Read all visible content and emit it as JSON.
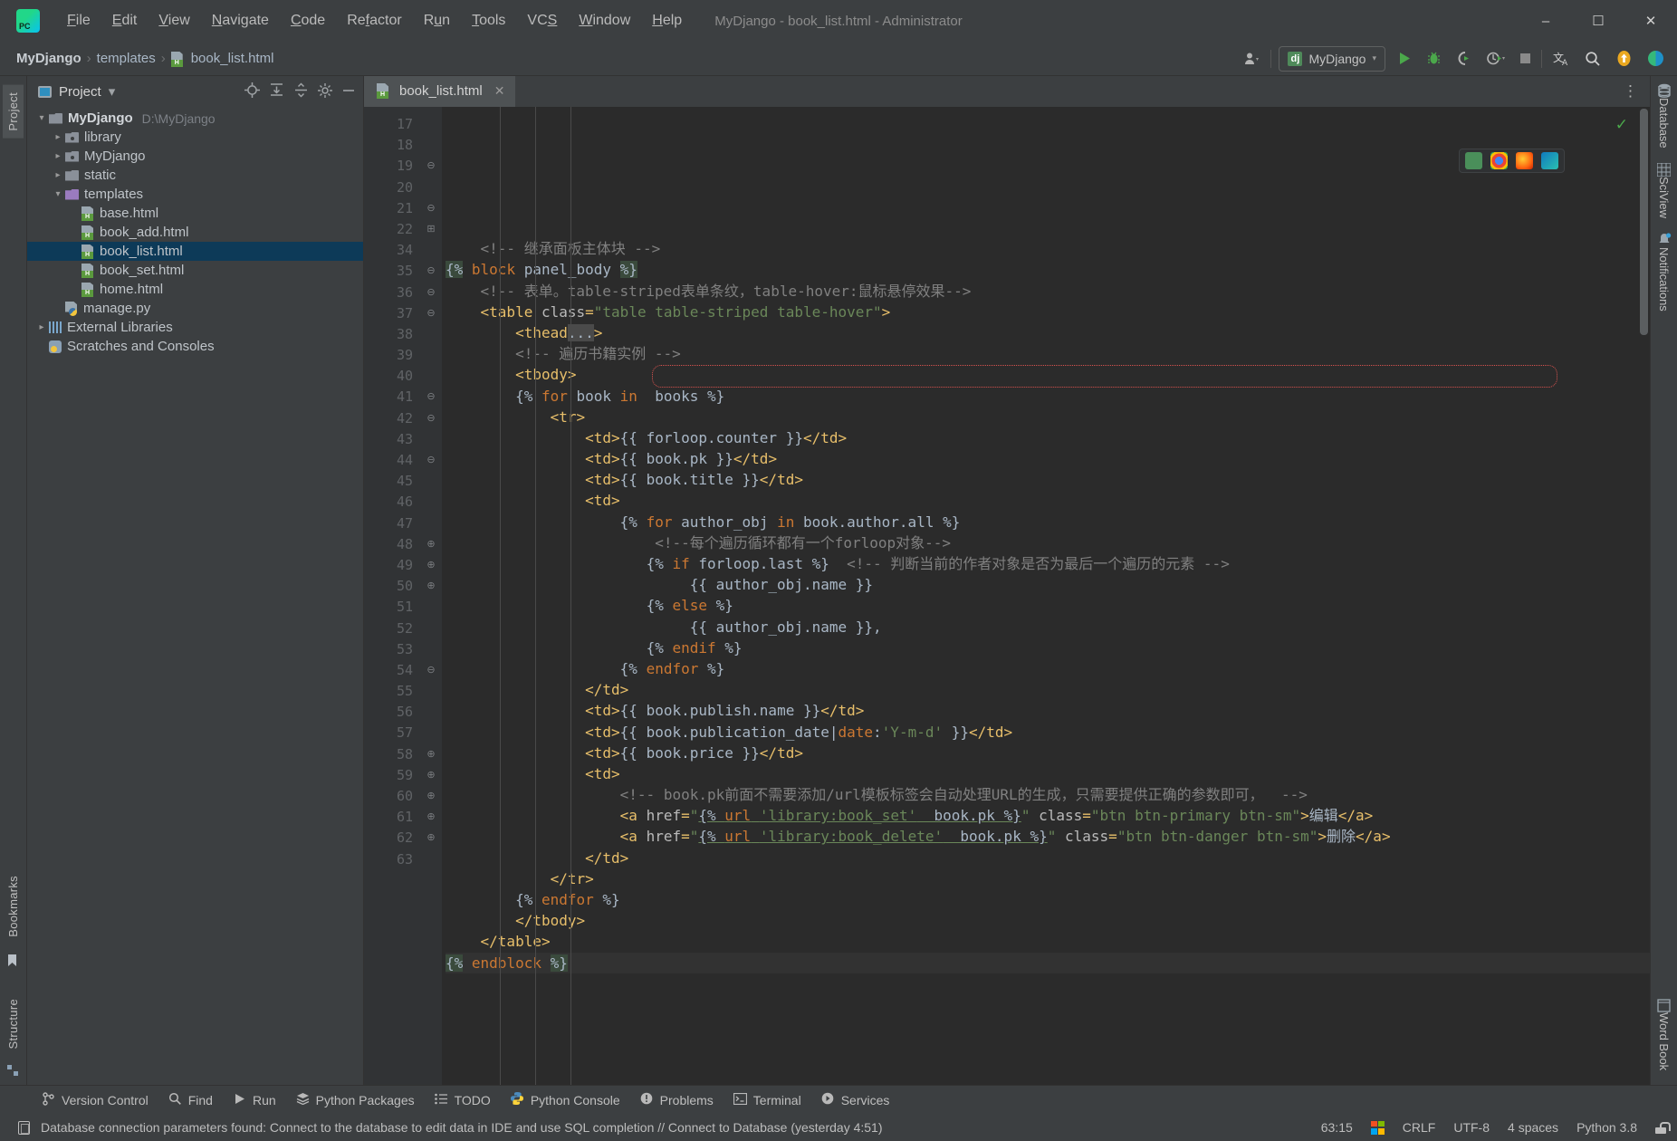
{
  "window": {
    "title": "MyDjango - book_list.html - Administrator",
    "minimize": "–",
    "maximize": "☐",
    "close": "✕"
  },
  "menu": {
    "items": [
      "File",
      "Edit",
      "View",
      "Navigate",
      "Code",
      "Refactor",
      "Run",
      "Tools",
      "VCS",
      "Window",
      "Help"
    ]
  },
  "breadcrumb": {
    "project": "MyDjango",
    "folder": "templates",
    "file": "book_list.html",
    "separator": "›"
  },
  "toolbar": {
    "run_config": "MyDjango",
    "run_config_icon": "dj",
    "caret": "▾",
    "icons": [
      "user-dropdown-icon",
      "run-icon",
      "debug-icon",
      "coverage-icon",
      "profile-icon",
      "stop-icon",
      "translate-icon",
      "search-icon",
      "update-icon",
      "ai-icon"
    ]
  },
  "left_rail": {
    "tabs": [
      "Project"
    ],
    "bottom_tabs": [
      "Bookmarks",
      "Structure"
    ]
  },
  "project": {
    "title": "Project",
    "dropdown_caret": "▾",
    "actions": [
      "locate-icon",
      "expand-all-icon",
      "collapse-all-icon",
      "settings-icon",
      "hide-icon"
    ],
    "tree": [
      {
        "label": "MyDjango",
        "path": "D:\\MyDjango",
        "arrow": "∨",
        "icon": "folder-icon",
        "indent": 0,
        "bold": true,
        "selected": false
      },
      {
        "label": "library",
        "path": "",
        "arrow": "›",
        "icon": "module-folder-icon",
        "indent": 1,
        "bold": false,
        "selected": false
      },
      {
        "label": "MyDjango",
        "path": "",
        "arrow": "›",
        "icon": "module-folder-icon",
        "indent": 1,
        "bold": false,
        "selected": false
      },
      {
        "label": "static",
        "path": "",
        "arrow": "›",
        "icon": "folder-icon",
        "indent": 1,
        "bold": false,
        "selected": false
      },
      {
        "label": "templates",
        "path": "",
        "arrow": "∨",
        "icon": "templates-folder-icon",
        "indent": 1,
        "bold": false,
        "selected": false
      },
      {
        "label": "base.html",
        "path": "",
        "arrow": "",
        "icon": "html-file-icon",
        "indent": 2,
        "bold": false,
        "selected": false
      },
      {
        "label": "book_add.html",
        "path": "",
        "arrow": "",
        "icon": "html-file-icon",
        "indent": 2,
        "bold": false,
        "selected": false
      },
      {
        "label": "book_list.html",
        "path": "",
        "arrow": "",
        "icon": "html-file-icon",
        "indent": 2,
        "bold": false,
        "selected": true
      },
      {
        "label": "book_set.html",
        "path": "",
        "arrow": "",
        "icon": "html-file-icon",
        "indent": 2,
        "bold": false,
        "selected": false
      },
      {
        "label": "home.html",
        "path": "",
        "arrow": "",
        "icon": "html-file-icon",
        "indent": 2,
        "bold": false,
        "selected": false
      },
      {
        "label": "manage.py",
        "path": "",
        "arrow": "",
        "icon": "python-file-icon",
        "indent": 1,
        "bold": false,
        "selected": false
      },
      {
        "label": "External Libraries",
        "path": "",
        "arrow": "›",
        "icon": "library-icon",
        "indent": 0,
        "bold": false,
        "selected": false
      },
      {
        "label": "Scratches and Consoles",
        "path": "",
        "arrow": "",
        "icon": "scratches-icon",
        "indent": 0,
        "bold": false,
        "selected": false
      }
    ]
  },
  "editor": {
    "tab": {
      "label": "book_list.html",
      "close": "✕"
    },
    "more_actions": "⋮",
    "inspection_ok": "✓",
    "lines": [
      {
        "no": "17",
        "fold": "",
        "text": ""
      },
      {
        "no": "18",
        "fold": "",
        "text": "    <!-- 继承面板主体块 -->"
      },
      {
        "no": "19",
        "fold": "⊖",
        "text": "{% block panel_body %}"
      },
      {
        "no": "20",
        "fold": "",
        "text": "    <!-- 表单。table-striped表单条纹，table-hover:鼠标悬停效果-->"
      },
      {
        "no": "21",
        "fold": "⊖",
        "text": "    <table class=\"table table-striped table-hover\">"
      },
      {
        "no": "22",
        "fold": "⊞",
        "text": "        <thead...>"
      },
      {
        "no": "34",
        "fold": "",
        "text": "        <!-- 遍历书籍实例 -->"
      },
      {
        "no": "35",
        "fold": "⊖",
        "text": "        <tbody>"
      },
      {
        "no": "36",
        "fold": "⊖",
        "text": "        {% for book in  books %}"
      },
      {
        "no": "37",
        "fold": "⊖",
        "text": "            <tr>"
      },
      {
        "no": "38",
        "fold": "",
        "text": "                <td>{{ forloop.counter }}</td>"
      },
      {
        "no": "39",
        "fold": "",
        "text": "                <td>{{ book.pk }}</td>"
      },
      {
        "no": "40",
        "fold": "",
        "text": "                <td>{{ book.title }}</td>"
      },
      {
        "no": "41",
        "fold": "⊖",
        "text": "                <td>"
      },
      {
        "no": "42",
        "fold": "⊖",
        "text": "                    {% for author_obj in book.author.all %}"
      },
      {
        "no": "43",
        "fold": "",
        "text": "                        <!--每个遍历循环都有一个forloop对象-->"
      },
      {
        "no": "44",
        "fold": "⊖",
        "text": "                       {% if forloop.last %}  <!-- 判断当前的作者对象是否为最后一个遍历的元素 -->"
      },
      {
        "no": "45",
        "fold": "",
        "text": "                            {{ author_obj.name }}"
      },
      {
        "no": "46",
        "fold": "",
        "text": "                       {% else %}"
      },
      {
        "no": "47",
        "fold": "",
        "text": "                            {{ author_obj.name }},"
      },
      {
        "no": "48",
        "fold": "⊕",
        "text": "                       {% endif %}"
      },
      {
        "no": "49",
        "fold": "⊕",
        "text": "                    {% endfor %}"
      },
      {
        "no": "50",
        "fold": "⊕",
        "text": "                </td>"
      },
      {
        "no": "51",
        "fold": "",
        "text": "                <td>{{ book.publish.name }}</td>"
      },
      {
        "no": "52",
        "fold": "",
        "text": "                <td>{{ book.publication_date|date:'Y-m-d' }}</td>"
      },
      {
        "no": "53",
        "fold": "",
        "text": "                <td>{{ book.price }}</td>"
      },
      {
        "no": "54",
        "fold": "⊖",
        "text": "                <td>"
      },
      {
        "no": "55",
        "fold": "",
        "text": "                    <!-- book.pk前面不需要添加/url模板标签会自动处理URL的生成，只需要提供正确的参数即可，  -->"
      },
      {
        "no": "56",
        "fold": "",
        "text": "                    <a href=\"{% url 'library:book_set'  book.pk %}\" class=\"btn btn-primary btn-sm\">编辑</a>"
      },
      {
        "no": "57",
        "fold": "",
        "text": "                    <a href=\"{% url 'library:book_delete'  book.pk %}\" class=\"btn btn-danger btn-sm\">删除</a>"
      },
      {
        "no": "58",
        "fold": "⊕",
        "text": "                </td>"
      },
      {
        "no": "59",
        "fold": "⊕",
        "text": "            </tr>"
      },
      {
        "no": "60",
        "fold": "⊕",
        "text": "        {% endfor %}"
      },
      {
        "no": "61",
        "fold": "⊕",
        "text": "        </tbody>"
      },
      {
        "no": "62",
        "fold": "⊕",
        "text": "    </table>"
      },
      {
        "no": "63",
        "fold": "",
        "text": "{% endblock %}"
      }
    ]
  },
  "right_rail": {
    "items": [
      "Database",
      "SciView",
      "Notifications",
      "Word Book"
    ]
  },
  "bottom_tools": [
    {
      "label": "Version Control",
      "icon": "branch-icon"
    },
    {
      "label": "Find",
      "icon": "search-icon"
    },
    {
      "label": "Run",
      "icon": "run-icon"
    },
    {
      "label": "Python Packages",
      "icon": "packages-icon"
    },
    {
      "label": "TODO",
      "icon": "todo-icon"
    },
    {
      "label": "Python Console",
      "icon": "python-icon"
    },
    {
      "label": "Problems",
      "icon": "problems-icon"
    },
    {
      "label": "Terminal",
      "icon": "terminal-icon"
    },
    {
      "label": "Services",
      "icon": "services-icon"
    }
  ],
  "status": {
    "message": "Database connection parameters found: Connect to the database to edit data in IDE and use SQL completion // Connect to Database (yesterday 4:51)",
    "message_icon": "event-log-icon",
    "caret_position": "63:15",
    "line_separator": "CRLF",
    "encoding": "UTF-8",
    "indent": "4 spaces",
    "interpreter": "Python 3.8",
    "lock_icon": "unlocked-icon",
    "os_icon": "windows-icon"
  },
  "colors": {
    "accent_selection": "#0d3a58",
    "editor_bg": "#2b2b2b",
    "chrome_bg": "#3c3f41",
    "tag": "#e8bf6a",
    "string": "#6a8759",
    "comment": "#808080",
    "keyword": "#cc7832",
    "error_box": "#d9534f"
  }
}
